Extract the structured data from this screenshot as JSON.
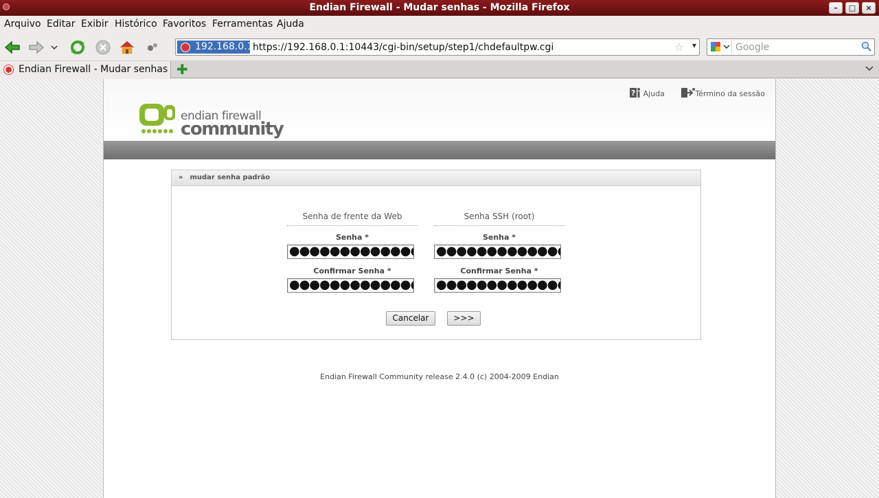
{
  "window": {
    "title": "Endian Firewall - Mudar senhas - Mozilla Firefox"
  },
  "menu": [
    "Arquivo",
    "Editar",
    "Exibir",
    "Histórico",
    "Favoritos",
    "Ferramentas",
    "Ajuda"
  ],
  "addressbar": {
    "site": "192.168.0.1",
    "url": "https://192.168.0.1:10443/cgi-bin/setup/step1/chdefaultpw.cgi"
  },
  "search": {
    "placeholder": "Google"
  },
  "tab": {
    "label": "Endian Firewall - Mudar senhas"
  },
  "header": {
    "help": "Ajuda",
    "logout": "Término da sessão",
    "logo_line1": "endian firewall",
    "logo_line2": "community"
  },
  "panel": {
    "title": "mudar senha padrão",
    "web": {
      "heading": "Senha de frente da Web",
      "password_label": "Senha *",
      "confirm_label": "Confirmar Senha *",
      "password_value": "●●●●●●●●●●●●●●",
      "confirm_value": "●●●●●●●●●●●●●●"
    },
    "ssh": {
      "heading": "Senha SSH (root)",
      "password_label": "Senha *",
      "confirm_label": "Confirmar Senha *",
      "password_value": "●●●●●●●●●●●●●●",
      "confirm_value": "●●●●●●●●●●●●●●"
    },
    "cancel": "Cancelar",
    "next": ">>>"
  },
  "footer": "Endian Firewall Community release 2.4.0 (c) 2004-2009 Endian",
  "colors": {
    "titlebar": "#7a1616",
    "accent_green": "#8ab82e",
    "site_identity": "#3d6fb7"
  }
}
